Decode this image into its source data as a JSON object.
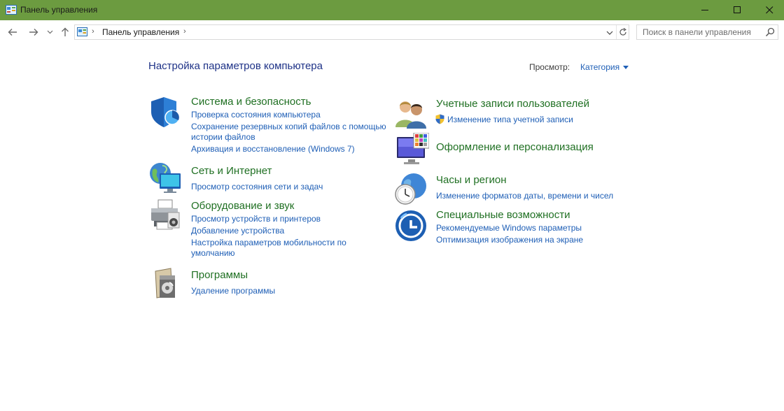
{
  "window": {
    "title": "Панель управления",
    "accent": "#6c9b40",
    "controls": [
      "minimize-icon",
      "maximize-icon",
      "close-icon"
    ]
  },
  "nav": {
    "back_icon": "arrow-left-icon",
    "forward_icon": "arrow-right-icon",
    "recent_icon": "chevron-down-icon",
    "up_icon": "arrow-up-icon",
    "address": {
      "path": "Панель управления",
      "separator": "›"
    },
    "refresh_icon": "refresh-icon",
    "search": {
      "placeholder": "Поиск в панели управления",
      "value": ""
    }
  },
  "main": {
    "heading": "Настройка параметров компьютера",
    "view_label": "Просмотр:",
    "view_value": "Категория",
    "categories": [
      {
        "icon": "shield-icon",
        "title": "Система и безопасность",
        "links": [
          "Проверка состояния компьютера",
          "Сохранение резервных копий файлов с помощью",
          "истории файлов",
          "Архивация и восстановление (Windows 7)"
        ]
      },
      {
        "icon": "network-globe-icon",
        "title": "Сеть и Интернет",
        "links": [
          "Просмотр состояния сети и задач"
        ]
      },
      {
        "icon": "printer-icon",
        "title": "Оборудование и звук",
        "links": [
          "Просмотр устройств и принтеров",
          "Добавление устройства",
          "Настройка параметров мобильности по",
          "умолчанию"
        ]
      },
      {
        "icon": "programs-icon",
        "title": "Программы",
        "links": [
          "Удаление программы"
        ]
      },
      {
        "icon": "users-icon",
        "title": "Учетные записи пользователей",
        "links": [
          "Изменение типа учетной записи"
        ]
      },
      {
        "icon": "personalization-icon",
        "title": "Оформление и персонализация",
        "links": []
      },
      {
        "icon": "clock-globe-icon",
        "title": "Часы и регион",
        "links": [
          "Изменение форматов даты, времени и чисел"
        ]
      },
      {
        "icon": "accessibility-icon",
        "title": "Специальные возможности",
        "links": [
          "Рекомендуемые Windows параметры",
          "Оптимизация изображения на экране"
        ]
      }
    ]
  },
  "colors": {
    "heading": "#1e3287",
    "category_title": "#207023",
    "link": "#1f5fb6"
  }
}
